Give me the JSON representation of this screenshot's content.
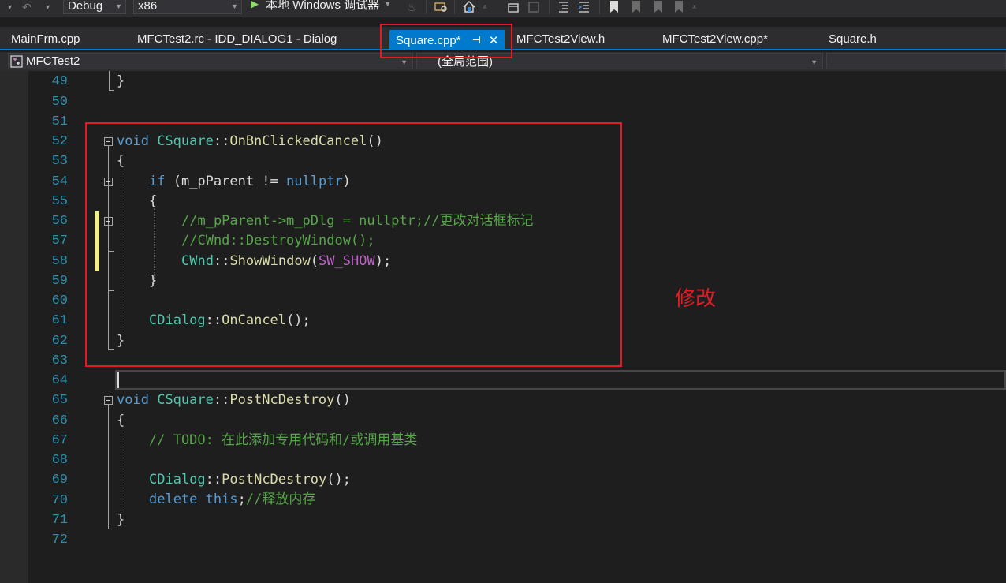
{
  "toolbar": {
    "config": "Debug",
    "platform": "x86",
    "debugger": "本地 Windows 调试器"
  },
  "tabs": [
    {
      "label": "MainFrm.cpp"
    },
    {
      "label": "MFCTest2.rc - IDD_DIALOG1 - Dialog"
    },
    {
      "label": "Square.cpp*",
      "pin": "⊣",
      "close": "✕"
    },
    {
      "label": "MFCTest2View.h"
    },
    {
      "label": "MFCTest2View.cpp*"
    },
    {
      "label": "Square.h"
    }
  ],
  "navbar": {
    "project": "MFCTest2",
    "scope": "(全局范围)"
  },
  "editor": {
    "line_numbers": [
      "49",
      "50",
      "51",
      "52",
      "53",
      "54",
      "55",
      "56",
      "57",
      "58",
      "59",
      "60",
      "61",
      "62",
      "63",
      "64",
      "65",
      "66",
      "67",
      "68",
      "69",
      "70",
      "71",
      "72"
    ],
    "code": {
      "l49": "}",
      "l52_kw": "void",
      "l52_ty": "CSquare",
      "l52_sep": "::",
      "l52_fn": "OnBnClickedCancel",
      "l52_rest": "()",
      "l53": "{",
      "l54_kw": "if",
      "l54_a": " (m_pParent != ",
      "l54_kw2": "nullptr",
      "l54_b": ")",
      "l55": "{",
      "l56": "//m_pParent->m_pDlg = nullptr;//更改对话框标记",
      "l57": "//CWnd::DestroyWindow();",
      "l58_ty": "CWnd",
      "l58_sep": "::",
      "l58_fn": "ShowWindow",
      "l58_a": "(",
      "l58_mac": "SW_SHOW",
      "l58_b": ");",
      "l59": "}",
      "l61_ty": "CDialog",
      "l61_sep": "::",
      "l61_fn": "OnCancel",
      "l61_rest": "();",
      "l62": "}",
      "l65_kw": "void",
      "l65_ty": "CSquare",
      "l65_sep": "::",
      "l65_fn": "PostNcDestroy",
      "l65_rest": "()",
      "l66": "{",
      "l67": "// TODO: 在此添加专用代码和/或调用基类",
      "l69_ty": "CDialog",
      "l69_sep": "::",
      "l69_fn": "PostNcDestroy",
      "l69_rest": "();",
      "l70_kw": "delete",
      "l70_sp": " ",
      "l70_kw2": "this",
      "l70_a": ";",
      "l70_cm": "//释放内存",
      "l71": "}"
    }
  },
  "annotation": {
    "text": "修改",
    "color": "#e51b24"
  },
  "colors": {
    "keyword": "#569cd6",
    "type": "#4ec9b0",
    "function": "#dcdcaa",
    "comment": "#57a64a",
    "macro": "#bd63c5",
    "line_number": "#2b91af",
    "active_tab": "#007acc"
  }
}
